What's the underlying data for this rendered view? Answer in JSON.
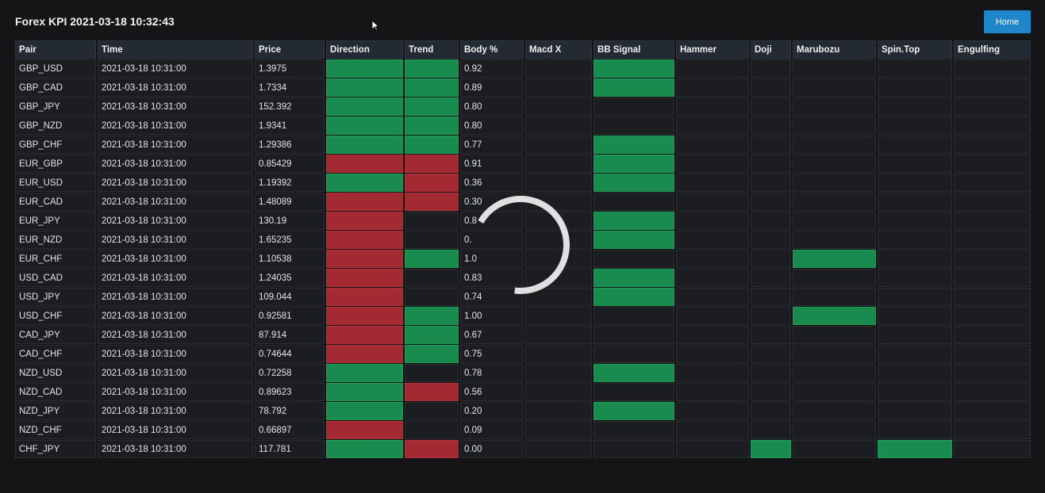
{
  "header": {
    "title": "Forex KPI 2021-03-18 10:32:43",
    "home_label": "Home"
  },
  "colors": {
    "green": "#1a8b4e",
    "red": "#a32a33",
    "button": "#1f86c9"
  },
  "columns": [
    "Pair",
    "Time",
    "Price",
    "Direction",
    "Trend",
    "Body %",
    "Macd X",
    "BB Signal",
    "Hammer",
    "Doji",
    "Marubozu",
    "Spin.Top",
    "Engulfing"
  ],
  "rows": [
    {
      "pair": "GBP_USD",
      "time": "2021-03-18 10:31:00",
      "price": "1.3975",
      "direction": "green",
      "trend": "green",
      "body": "0.92",
      "macd": "",
      "bb": "green",
      "hammer": "",
      "doji": "",
      "marubozu": "",
      "spintop": "",
      "engulfing": ""
    },
    {
      "pair": "GBP_CAD",
      "time": "2021-03-18 10:31:00",
      "price": "1.7334",
      "direction": "green",
      "trend": "green",
      "body": "0.89",
      "macd": "",
      "bb": "green",
      "hammer": "",
      "doji": "",
      "marubozu": "",
      "spintop": "",
      "engulfing": ""
    },
    {
      "pair": "GBP_JPY",
      "time": "2021-03-18 10:31:00",
      "price": "152.392",
      "direction": "green",
      "trend": "green",
      "body": "0.80",
      "macd": "",
      "bb": "",
      "hammer": "",
      "doji": "",
      "marubozu": "",
      "spintop": "",
      "engulfing": ""
    },
    {
      "pair": "GBP_NZD",
      "time": "2021-03-18 10:31:00",
      "price": "1.9341",
      "direction": "green",
      "trend": "green",
      "body": "0.80",
      "macd": "",
      "bb": "",
      "hammer": "",
      "doji": "",
      "marubozu": "",
      "spintop": "",
      "engulfing": ""
    },
    {
      "pair": "GBP_CHF",
      "time": "2021-03-18 10:31:00",
      "price": "1.29386",
      "direction": "green",
      "trend": "green",
      "body": "0.77",
      "macd": "",
      "bb": "green",
      "hammer": "",
      "doji": "",
      "marubozu": "",
      "spintop": "",
      "engulfing": ""
    },
    {
      "pair": "EUR_GBP",
      "time": "2021-03-18 10:31:00",
      "price": "0.85429",
      "direction": "red",
      "trend": "red",
      "body": "0.91",
      "macd": "",
      "bb": "green",
      "hammer": "",
      "doji": "",
      "marubozu": "",
      "spintop": "",
      "engulfing": ""
    },
    {
      "pair": "EUR_USD",
      "time": "2021-03-18 10:31:00",
      "price": "1.19392",
      "direction": "green",
      "trend": "red",
      "body": "0.36",
      "macd": "",
      "bb": "green",
      "hammer": "",
      "doji": "",
      "marubozu": "",
      "spintop": "",
      "engulfing": ""
    },
    {
      "pair": "EUR_CAD",
      "time": "2021-03-18 10:31:00",
      "price": "1.48089",
      "direction": "red",
      "trend": "red",
      "body": "0.30",
      "macd": "",
      "bb": "",
      "hammer": "",
      "doji": "",
      "marubozu": "",
      "spintop": "",
      "engulfing": ""
    },
    {
      "pair": "EUR_JPY",
      "time": "2021-03-18 10:31:00",
      "price": "130.19",
      "direction": "red",
      "trend": "",
      "body": "0.8",
      "macd": "",
      "bb": "green",
      "hammer": "",
      "doji": "",
      "marubozu": "",
      "spintop": "",
      "engulfing": ""
    },
    {
      "pair": "EUR_NZD",
      "time": "2021-03-18 10:31:00",
      "price": "1.65235",
      "direction": "red",
      "trend": "",
      "body": "0.",
      "macd": "",
      "bb": "green",
      "hammer": "",
      "doji": "",
      "marubozu": "",
      "spintop": "",
      "engulfing": ""
    },
    {
      "pair": "EUR_CHF",
      "time": "2021-03-18 10:31:00",
      "price": "1.10538",
      "direction": "red",
      "trend": "green",
      "body": "1.0",
      "macd": "",
      "bb": "",
      "hammer": "",
      "doji": "",
      "marubozu": "green",
      "spintop": "",
      "engulfing": ""
    },
    {
      "pair": "USD_CAD",
      "time": "2021-03-18 10:31:00",
      "price": "1.24035",
      "direction": "red",
      "trend": "",
      "body": "0.83",
      "macd": "",
      "bb": "green",
      "hammer": "",
      "doji": "",
      "marubozu": "",
      "spintop": "",
      "engulfing": ""
    },
    {
      "pair": "USD_JPY",
      "time": "2021-03-18 10:31:00",
      "price": "109.044",
      "direction": "red",
      "trend": "",
      "body": "0.74",
      "macd": "",
      "bb": "green",
      "hammer": "",
      "doji": "",
      "marubozu": "",
      "spintop": "",
      "engulfing": ""
    },
    {
      "pair": "USD_CHF",
      "time": "2021-03-18 10:31:00",
      "price": "0.92581",
      "direction": "red",
      "trend": "green",
      "body": "1.00",
      "macd": "",
      "bb": "",
      "hammer": "",
      "doji": "",
      "marubozu": "green",
      "spintop": "",
      "engulfing": ""
    },
    {
      "pair": "CAD_JPY",
      "time": "2021-03-18 10:31:00",
      "price": "87.914",
      "direction": "red",
      "trend": "green",
      "body": "0.67",
      "macd": "",
      "bb": "",
      "hammer": "",
      "doji": "",
      "marubozu": "",
      "spintop": "",
      "engulfing": ""
    },
    {
      "pair": "CAD_CHF",
      "time": "2021-03-18 10:31:00",
      "price": "0.74644",
      "direction": "red",
      "trend": "green",
      "body": "0.75",
      "macd": "",
      "bb": "",
      "hammer": "",
      "doji": "",
      "marubozu": "",
      "spintop": "",
      "engulfing": ""
    },
    {
      "pair": "NZD_USD",
      "time": "2021-03-18 10:31:00",
      "price": "0.72258",
      "direction": "green",
      "trend": "",
      "body": "0.78",
      "macd": "",
      "bb": "green",
      "hammer": "",
      "doji": "",
      "marubozu": "",
      "spintop": "",
      "engulfing": ""
    },
    {
      "pair": "NZD_CAD",
      "time": "2021-03-18 10:31:00",
      "price": "0.89623",
      "direction": "green",
      "trend": "red",
      "body": "0.56",
      "macd": "",
      "bb": "",
      "hammer": "",
      "doji": "",
      "marubozu": "",
      "spintop": "",
      "engulfing": ""
    },
    {
      "pair": "NZD_JPY",
      "time": "2021-03-18 10:31:00",
      "price": "78.792",
      "direction": "green",
      "trend": "",
      "body": "0.20",
      "macd": "",
      "bb": "green",
      "hammer": "",
      "doji": "",
      "marubozu": "",
      "spintop": "",
      "engulfing": ""
    },
    {
      "pair": "NZD_CHF",
      "time": "2021-03-18 10:31:00",
      "price": "0.66897",
      "direction": "red",
      "trend": "",
      "body": "0.09",
      "macd": "",
      "bb": "",
      "hammer": "",
      "doji": "",
      "marubozu": "",
      "spintop": "",
      "engulfing": ""
    },
    {
      "pair": "CHF_JPY",
      "time": "2021-03-18 10:31:00",
      "price": "117.781",
      "direction": "green",
      "trend": "red",
      "body": "0.00",
      "macd": "",
      "bb": "",
      "hammer": "",
      "doji": "green",
      "marubozu": "",
      "spintop": "green",
      "engulfing": ""
    }
  ]
}
